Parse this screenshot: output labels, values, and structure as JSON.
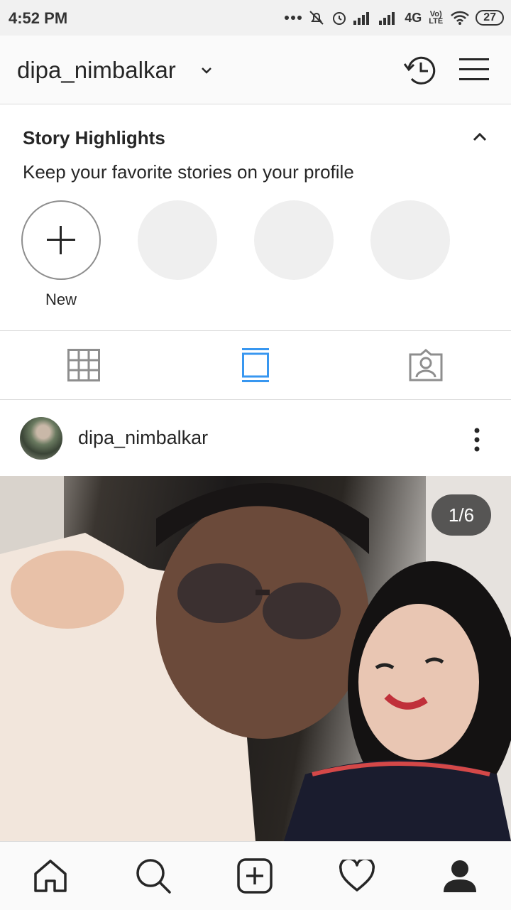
{
  "status_bar": {
    "time": "4:52 PM",
    "network": "4G",
    "volte": "Vo) LTE",
    "battery": "27"
  },
  "header": {
    "username": "dipa_nimbalkar"
  },
  "highlights": {
    "title": "Story Highlights",
    "subtitle": "Keep your favorite stories on your profile",
    "new_label": "New"
  },
  "post": {
    "username": "dipa_nimbalkar",
    "counter": "1/6"
  },
  "colors": {
    "active_tab": "#3897f0",
    "inactive_tab": "#8e8e8e"
  }
}
